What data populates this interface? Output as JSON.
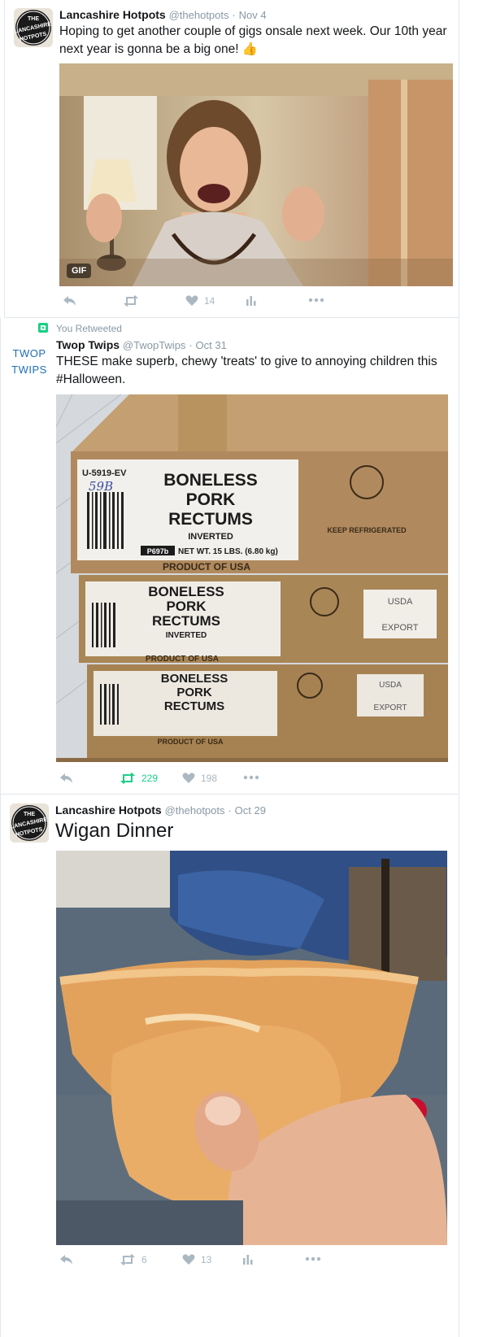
{
  "tweets": [
    {
      "author": "Lancashire Hotpots",
      "handle": "@thehotpots",
      "date": "Nov 4",
      "text": "Hoping to get another couple of gigs onsale next week. Our 10th year next year is gonna be a big one! 👍",
      "media_badge": "GIF",
      "like_count": "14",
      "retweet_count": ""
    },
    {
      "retweet_note": "You Retweeted",
      "author": "Twop Twips",
      "handle": "@TwopTwips",
      "date": "Oct 31",
      "text": "THESE make superb, chewy 'treats' to give to annoying children this #Halloween.",
      "box_labels": {
        "code": "U-5919-EV",
        "handwritten": "59B",
        "line1": "BONELESS",
        "line2": "PORK",
        "line3": "RECTUMS",
        "sub": "INVERTED",
        "weight": "NET WT. 15 LBS. (6.80 kg)",
        "weight_code": "P697b",
        "origin": "PRODUCT OF USA",
        "keep": "KEEP REFRIGERATED",
        "usda": "USDA",
        "export": "EXPORT"
      },
      "retweet_count": "229",
      "like_count": "198"
    },
    {
      "author": "Lancashire Hotpots",
      "handle": "@thehotpots",
      "date": "Oct 29",
      "text": "Wigan Dinner",
      "retweet_count": "6",
      "like_count": "13"
    }
  ],
  "avatars": {
    "hotpots_text": [
      "THE",
      "LANCASHIRE",
      "HOTPOTS"
    ],
    "twop_text": [
      "TWOP",
      "TWIPS"
    ]
  },
  "colors": {
    "meta": "#8899a6",
    "icon": "#aab8c2",
    "retweet_green": "#19cf86",
    "twop_blue": "#1d6fb8"
  },
  "separator": "·"
}
